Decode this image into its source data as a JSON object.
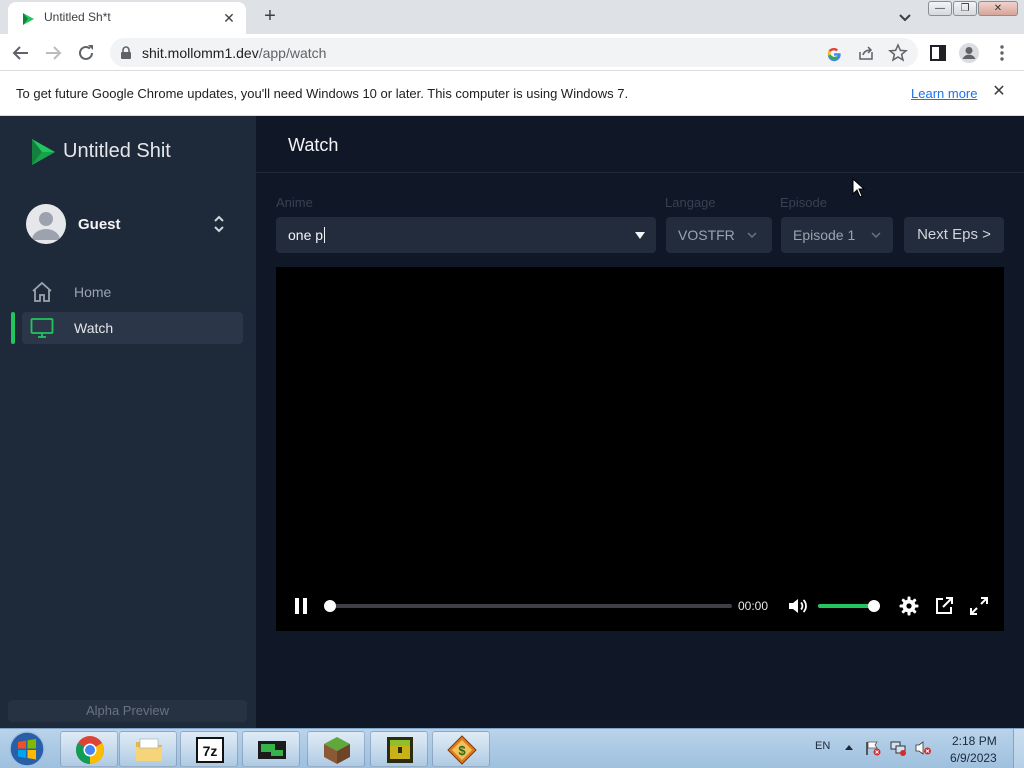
{
  "browser": {
    "tab_title": "Untitled Sh*t",
    "url_host": "shit.mollomm1.dev",
    "url_path": "/app/watch",
    "minimize_glyph": "—",
    "restore_glyph": "❐",
    "close_glyph": "✕"
  },
  "infobar": {
    "message": "To get future Google Chrome updates, you'll need Windows 10 or later. This computer is using Windows 7.",
    "link_label": "Learn more"
  },
  "sidebar": {
    "brand": "Untitled Shit",
    "user_name": "Guest",
    "items": [
      {
        "label": "Home",
        "icon": "home-icon"
      },
      {
        "label": "Watch",
        "icon": "monitor-icon",
        "active": true
      }
    ],
    "footer": "Alpha Preview"
  },
  "main": {
    "title": "Watch",
    "filters": {
      "anime_label": "Anime",
      "anime_value": "one p",
      "language_label": "Langage",
      "language_value": "VOSTFR",
      "episode_label": "Episode",
      "episode_value": "Episode 1"
    },
    "next_button": "Next Eps >",
    "player": {
      "time": "00:00",
      "progress": 0,
      "volume": 0.9
    }
  },
  "taskbar": {
    "tray_lang": "EN",
    "clock_time": "2:18 PM",
    "clock_date": "6/9/2023"
  },
  "colors": {
    "accent": "#22c55e",
    "sidebar_bg": "#1e2939",
    "main_bg": "#101827"
  }
}
